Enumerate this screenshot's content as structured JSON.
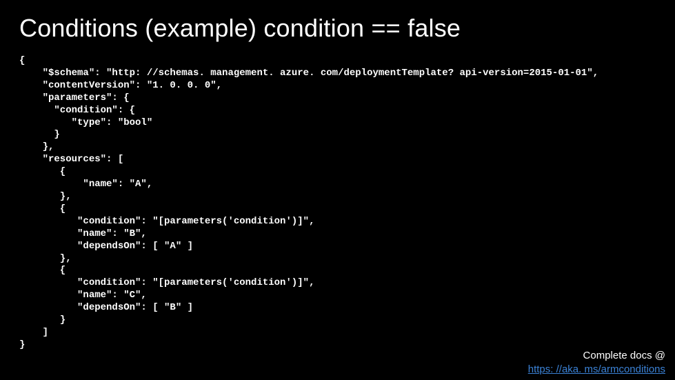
{
  "title": "Conditions  (example) condition == false",
  "code": "{\n    \"$schema\": \"http: //schemas. management. azure. com/deploymentTemplate? api-version=2015-01-01\",\n    \"contentVersion\": \"1. 0. 0. 0\",\n    \"parameters\": {\n      \"condition\": {\n         \"type\": \"bool\"\n      }\n    },\n    \"resources\": [\n       {\n           \"name\": \"A\",\n       },\n       {\n          \"condition\": \"[parameters('condition')]\",\n          \"name\": \"B\",\n          \"dependsOn\": [ \"A\" ]\n       },\n       {\n          \"condition\": \"[parameters('condition')]\",\n          \"name\": \"C\",\n          \"dependsOn\": [ \"B\" ]\n       }\n    ]\n}",
  "footer": {
    "text": "Complete docs @",
    "link": "https: //aka. ms/armconditions"
  }
}
